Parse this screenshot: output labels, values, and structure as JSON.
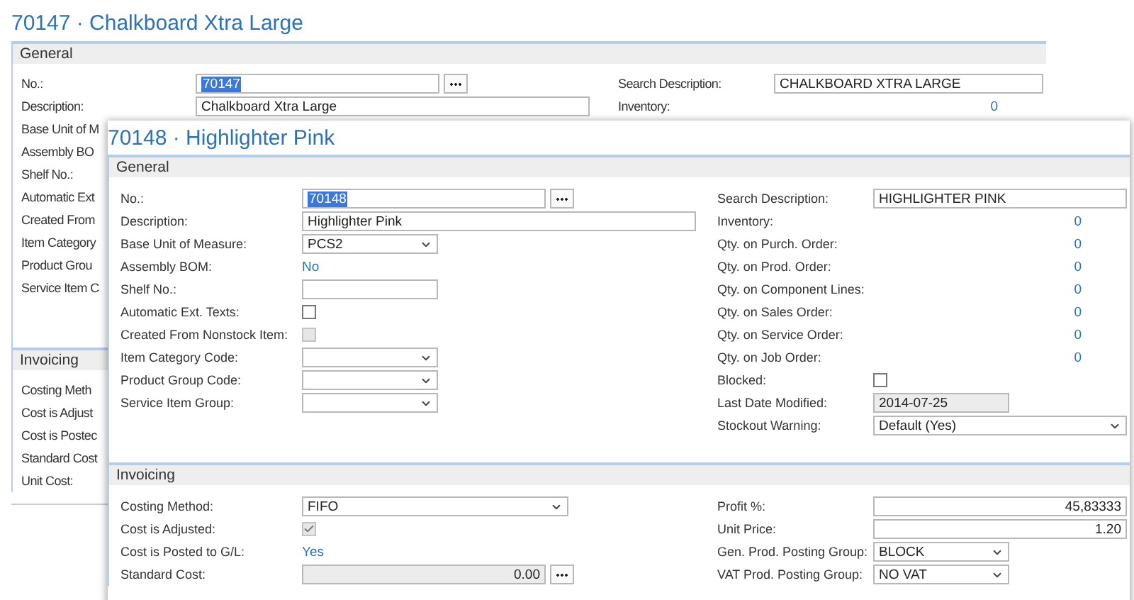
{
  "windows": [
    {
      "title": "70147 · Chalkboard Xtra Large",
      "sections": [
        {
          "title": "General",
          "left": [
            {
              "label": "No.:",
              "kind": "lookup",
              "value": "70147",
              "highlighted": true
            },
            {
              "label": "Description:",
              "kind": "text",
              "value": "Chalkboard Xtra Large"
            },
            {
              "label": "Base Unit of M"
            },
            {
              "label": "Assembly BO"
            },
            {
              "label": "Shelf No.:"
            },
            {
              "label": "Automatic Ext"
            },
            {
              "label": "Created From"
            },
            {
              "label": "Item Category"
            },
            {
              "label": "Product Grou"
            },
            {
              "label": "Service Item C"
            }
          ],
          "right": [
            {
              "label": "Search Description:",
              "kind": "text",
              "value": "CHALKBOARD XTRA LARGE"
            },
            {
              "label": "Inventory:",
              "kind": "amount",
              "value": "0"
            }
          ]
        },
        {
          "title": "Invoicing",
          "left": [
            {
              "label": "Costing Meth"
            },
            {
              "label": "Cost is Adjust"
            },
            {
              "label": "Cost is Postec"
            },
            {
              "label": "Standard Cost"
            },
            {
              "label": "Unit Cost:"
            }
          ]
        }
      ]
    },
    {
      "title": "70148 · Highlighter Pink",
      "sections": [
        {
          "title": "General",
          "left": [
            {
              "label": "No.:",
              "kind": "lookup",
              "value": "70148",
              "highlighted": true
            },
            {
              "label": "Description:",
              "kind": "text",
              "value": "Highlighter Pink"
            },
            {
              "label": "Base Unit of Measure:",
              "kind": "dropdown",
              "value": "PCS2"
            },
            {
              "label": "Assembly BOM:",
              "kind": "link",
              "value": "No"
            },
            {
              "label": "Shelf No.:",
              "kind": "text"
            },
            {
              "label": "Automatic Ext. Texts:",
              "kind": "checkbox",
              "checked": false,
              "disabled": false
            },
            {
              "label": "Created From Nonstock Item:",
              "kind": "checkbox",
              "checked": false,
              "disabled": true
            },
            {
              "label": "Item Category Code:",
              "kind": "dropdown"
            },
            {
              "label": "Product Group Code:",
              "kind": "dropdown"
            },
            {
              "label": "Service Item Group:",
              "kind": "dropdown"
            }
          ],
          "right": [
            {
              "label": "Search Description:",
              "kind": "text",
              "value": "HIGHLIGHTER PINK"
            },
            {
              "label": "Inventory:",
              "kind": "amount",
              "value": "0"
            },
            {
              "label": "Qty. on Purch. Order:",
              "kind": "amount",
              "value": "0"
            },
            {
              "label": "Qty. on Prod. Order:",
              "kind": "amount",
              "value": "0"
            },
            {
              "label": "Qty. on Component Lines:",
              "kind": "amount",
              "value": "0"
            },
            {
              "label": "Qty. on Sales Order:",
              "kind": "amount",
              "value": "0"
            },
            {
              "label": "Qty. on Service Order:",
              "kind": "amount",
              "value": "0"
            },
            {
              "label": "Qty. on Job Order:",
              "kind": "amount",
              "value": "0"
            },
            {
              "label": "Blocked:",
              "kind": "checkbox",
              "checked": false,
              "disabled": false
            },
            {
              "label": "Last Date Modified:",
              "kind": "text",
              "value": "2014-07-25",
              "disabled": true
            },
            {
              "label": "Stockout Warning:",
              "kind": "dropdown",
              "value": "Default (Yes)"
            }
          ]
        },
        {
          "title": "Invoicing",
          "left": [
            {
              "label": "Costing Method:",
              "kind": "dropdown",
              "value": "FIFO"
            },
            {
              "label": "Cost is Adjusted:",
              "kind": "checkbox",
              "checked": true,
              "disabled": true
            },
            {
              "label": "Cost is Posted to G/L:",
              "kind": "link",
              "value": "Yes"
            },
            {
              "label": "Standard Cost:",
              "kind": "lookup",
              "value": "0.00",
              "disabled": true,
              "numeric": true
            }
          ],
          "right": [
            {
              "label": "Profit %:",
              "kind": "text",
              "value": "45,83333",
              "numeric": true
            },
            {
              "label": "Unit Price:",
              "kind": "text",
              "value": "1.20",
              "numeric": true
            },
            {
              "label": "Gen. Prod. Posting Group:",
              "kind": "dropdown",
              "value": "BLOCK"
            },
            {
              "label": "VAT Prod. Posting Group:",
              "kind": "dropdown",
              "value": "NO VAT"
            }
          ]
        }
      ]
    }
  ]
}
